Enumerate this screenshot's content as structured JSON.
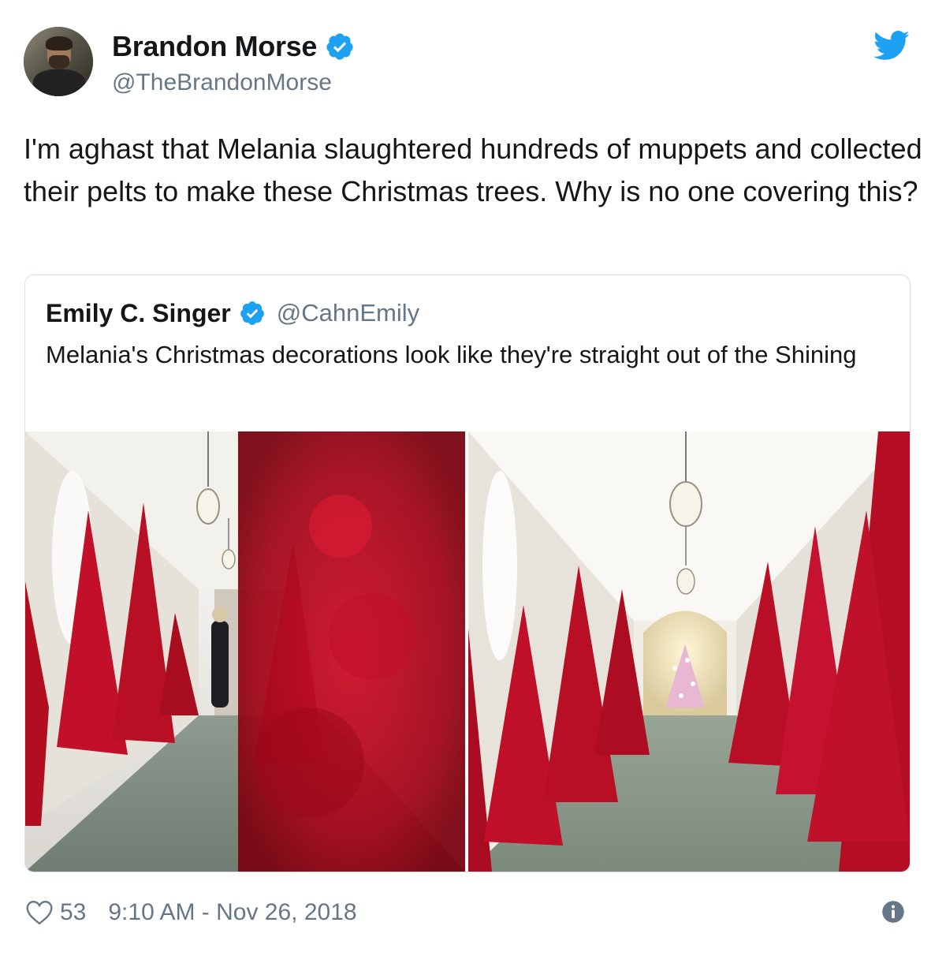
{
  "tweet": {
    "display_name": "Brandon Morse",
    "handle": "@TheBrandonMorse",
    "text": "I'm aghast that Melania slaughtered hundreds of muppets and collected their pelts to make these Christmas trees. Why is no one covering this?",
    "verified": true
  },
  "quoted": {
    "display_name": "Emily C. Singer",
    "handle": "@CahnEmily",
    "text": "Melania's Christmas decorations look like they're straight out of the Shining",
    "verified": true,
    "media_count": 2
  },
  "footer": {
    "like_count": "53",
    "timestamp": "9:10 AM - Nov 26, 2018"
  },
  "icons": [
    "twitter-bird-icon",
    "verified-badge-icon",
    "heart-icon",
    "info-icon"
  ],
  "colors": {
    "twitter_blue": "#1da1f2",
    "secondary_text": "#657786",
    "primary_text": "#14171a",
    "border": "#d8e0e6"
  }
}
